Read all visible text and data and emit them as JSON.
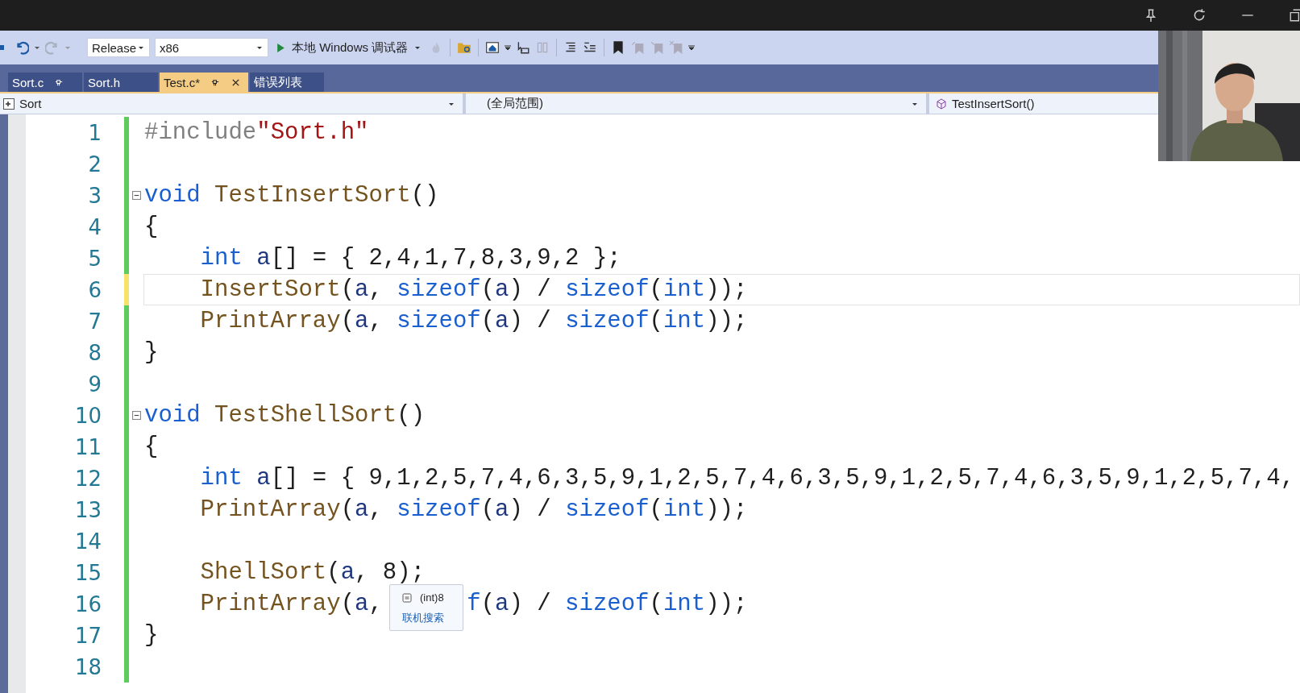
{
  "toolbar": {
    "configuration": "Release",
    "platform": "x86",
    "run_label": "本地 Windows 调试器"
  },
  "tabs": [
    {
      "label": "Sort.c",
      "selected": false,
      "pinned": true,
      "closable": false
    },
    {
      "label": "Sort.h",
      "selected": false,
      "pinned": false,
      "closable": false
    },
    {
      "label": "Test.c*",
      "selected": true,
      "pinned": true,
      "closable": true
    },
    {
      "label": "错误列表",
      "selected": false,
      "pinned": false,
      "closable": false
    }
  ],
  "nav": {
    "project": "Sort",
    "scope": "(全局范围)",
    "member": "TestInsertSort()"
  },
  "editor": {
    "lines": [
      {
        "number": "1",
        "unsaved": false,
        "current": false,
        "foldable": false,
        "indented": false,
        "tokens": [
          {
            "kind": "preproc",
            "text": "#include"
          },
          {
            "kind": "string",
            "text": "\"Sort.h\""
          }
        ]
      },
      {
        "number": "2",
        "unsaved": false,
        "current": false,
        "foldable": false
      },
      {
        "number": "3",
        "unsaved": false,
        "current": false,
        "foldable": true,
        "indented": false,
        "tokens": [
          {
            "kind": "keyword",
            "text": "void "
          },
          {
            "kind": "function",
            "text": "TestInsertSort"
          },
          {
            "kind": "plain",
            "text": "()"
          }
        ]
      },
      {
        "number": "4",
        "unsaved": false,
        "current": false,
        "foldable": false,
        "indented": false,
        "tokens": [
          {
            "kind": "plain",
            "text": "{"
          }
        ]
      },
      {
        "number": "5",
        "unsaved": false,
        "current": false,
        "foldable": false,
        "indented": true,
        "tokens": [
          {
            "kind": "keyword",
            "text": "int "
          },
          {
            "kind": "variable",
            "text": "a"
          },
          {
            "kind": "plain",
            "text": "[] = { 2,4,1,7,8,3,9,2 };"
          }
        ]
      },
      {
        "number": "6",
        "unsaved": true,
        "current": true,
        "foldable": false,
        "indented": true,
        "tokens": [
          {
            "kind": "function",
            "text": "InsertSort"
          },
          {
            "kind": "plain",
            "text": "("
          },
          {
            "kind": "variable",
            "text": "a"
          },
          {
            "kind": "plain",
            "text": ", "
          },
          {
            "kind": "keyword",
            "text": "sizeof"
          },
          {
            "kind": "plain",
            "text": "("
          },
          {
            "kind": "variable",
            "text": "a"
          },
          {
            "kind": "plain",
            "text": ") / "
          },
          {
            "kind": "keyword",
            "text": "sizeof"
          },
          {
            "kind": "plain",
            "text": "("
          },
          {
            "kind": "keyword",
            "text": "int"
          },
          {
            "kind": "plain",
            "text": "));"
          }
        ]
      },
      {
        "number": "7",
        "unsaved": false,
        "current": false,
        "foldable": false,
        "indented": true,
        "tokens": [
          {
            "kind": "function",
            "text": "PrintArray"
          },
          {
            "kind": "plain",
            "text": "("
          },
          {
            "kind": "variable",
            "text": "a"
          },
          {
            "kind": "plain",
            "text": ", "
          },
          {
            "kind": "keyword",
            "text": "sizeof"
          },
          {
            "kind": "plain",
            "text": "("
          },
          {
            "kind": "variable",
            "text": "a"
          },
          {
            "kind": "plain",
            "text": ") / "
          },
          {
            "kind": "keyword",
            "text": "sizeof"
          },
          {
            "kind": "plain",
            "text": "("
          },
          {
            "kind": "keyword",
            "text": "int"
          },
          {
            "kind": "plain",
            "text": "));"
          }
        ]
      },
      {
        "number": "8",
        "unsaved": false,
        "current": false,
        "foldable": false,
        "indented": false,
        "tokens": [
          {
            "kind": "plain",
            "text": "}"
          }
        ]
      },
      {
        "number": "9",
        "unsaved": false,
        "current": false,
        "foldable": false
      },
      {
        "number": "10",
        "unsaved": false,
        "current": false,
        "foldable": true,
        "indented": false,
        "tokens": [
          {
            "kind": "keyword",
            "text": "void "
          },
          {
            "kind": "function",
            "text": "TestShellSort"
          },
          {
            "kind": "plain",
            "text": "()"
          }
        ]
      },
      {
        "number": "11",
        "unsaved": false,
        "current": false,
        "foldable": false,
        "indented": false,
        "tokens": [
          {
            "kind": "plain",
            "text": "{"
          }
        ]
      },
      {
        "number": "12",
        "unsaved": false,
        "current": false,
        "foldable": false,
        "indented": true,
        "tokens": [
          {
            "kind": "keyword",
            "text": "int "
          },
          {
            "kind": "variable",
            "text": "a"
          },
          {
            "kind": "plain",
            "text": "[] = { 9,1,2,5,7,4,6,3,5,9,1,2,5,7,4,6,3,5,9,1,2,5,7,4,6,3,5,9,1,2,5,7,4,"
          }
        ]
      },
      {
        "number": "13",
        "unsaved": false,
        "current": false,
        "foldable": false,
        "indented": true,
        "tokens": [
          {
            "kind": "function",
            "text": "PrintArray"
          },
          {
            "kind": "plain",
            "text": "("
          },
          {
            "kind": "variable",
            "text": "a"
          },
          {
            "kind": "plain",
            "text": ", "
          },
          {
            "kind": "keyword",
            "text": "sizeof"
          },
          {
            "kind": "plain",
            "text": "("
          },
          {
            "kind": "variable",
            "text": "a"
          },
          {
            "kind": "plain",
            "text": ") / "
          },
          {
            "kind": "keyword",
            "text": "sizeof"
          },
          {
            "kind": "plain",
            "text": "("
          },
          {
            "kind": "keyword",
            "text": "int"
          },
          {
            "kind": "plain",
            "text": "));"
          }
        ]
      },
      {
        "number": "14",
        "unsaved": false,
        "current": false,
        "foldable": false
      },
      {
        "number": "15",
        "unsaved": false,
        "current": false,
        "foldable": false,
        "indented": true,
        "tokens": [
          {
            "kind": "function",
            "text": "ShellSort"
          },
          {
            "kind": "plain",
            "text": "("
          },
          {
            "kind": "variable",
            "text": "a"
          },
          {
            "kind": "plain",
            "text": ", 8);"
          }
        ]
      },
      {
        "number": "16",
        "unsaved": false,
        "current": false,
        "foldable": false,
        "indented": true,
        "tokens": [
          {
            "kind": "function",
            "text": "PrintArray"
          },
          {
            "kind": "plain",
            "text": "("
          },
          {
            "kind": "variable",
            "text": "a"
          },
          {
            "kind": "plain",
            "text": ","
          },
          {
            "kind": "keyword",
            "text": "f",
            "after_tooltip": true
          },
          {
            "kind": "plain",
            "text": "("
          },
          {
            "kind": "variable",
            "text": "a"
          },
          {
            "kind": "plain",
            "text": ") / "
          },
          {
            "kind": "keyword",
            "text": "sizeof"
          },
          {
            "kind": "plain",
            "text": "("
          },
          {
            "kind": "keyword",
            "text": "int"
          },
          {
            "kind": "plain",
            "text": "));"
          }
        ]
      },
      {
        "number": "17",
        "unsaved": false,
        "current": false,
        "foldable": false,
        "indented": false,
        "tokens": [
          {
            "kind": "plain",
            "text": "}"
          }
        ]
      },
      {
        "number": "18",
        "unsaved": false,
        "current": false,
        "foldable": false
      }
    ]
  },
  "tooltip": {
    "value": "(int)8",
    "link": "联机搜索"
  }
}
